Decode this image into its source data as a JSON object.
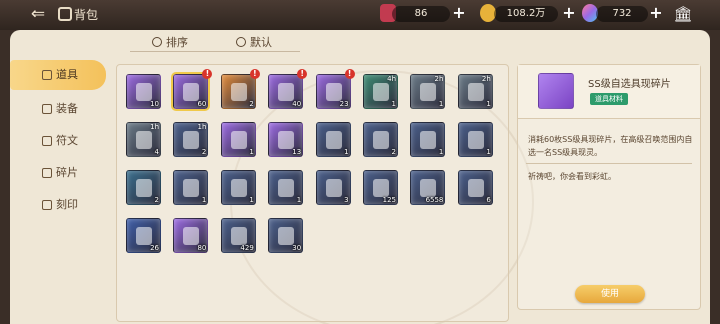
{
  "header": {
    "title": "背包",
    "back_icon": "back-arrow-icon",
    "bag_icon": "bag-icon",
    "resources": [
      {
        "name": "stamina-ticket",
        "value": "86",
        "color": "#c23b50"
      },
      {
        "name": "gold-coin",
        "value": "108.2万",
        "color": "#e7b23a"
      },
      {
        "name": "rainbow-gem",
        "value": "732",
        "color": "#9a6ae6"
      }
    ],
    "plus_label": "+",
    "bank_icon": "bank-icon"
  },
  "sortbar": {
    "sort_label": "排序",
    "default_label": "默认"
  },
  "sidebar": {
    "items": [
      {
        "label": "道具",
        "icon": "flask-icon",
        "active": true
      },
      {
        "label": "装备",
        "icon": "sword-icon",
        "active": false
      },
      {
        "label": "符文",
        "icon": "rune-icon",
        "active": false
      },
      {
        "label": "碎片",
        "icon": "shard-icon",
        "active": false
      },
      {
        "label": "刻印",
        "icon": "seal-icon",
        "active": false
      }
    ]
  },
  "items": [
    {
      "count": "10",
      "time": "",
      "alert": false,
      "color": "#9b6ae0",
      "selected": false
    },
    {
      "count": "60",
      "time": "",
      "alert": true,
      "color": "#9b6ae0",
      "selected": true
    },
    {
      "count": "2",
      "time": "",
      "alert": true,
      "color": "#e08a3a",
      "selected": false
    },
    {
      "count": "40",
      "time": "",
      "alert": true,
      "color": "#9b6ae0",
      "selected": false
    },
    {
      "count": "23",
      "time": "",
      "alert": true,
      "color": "#9b6ae0",
      "selected": false
    },
    {
      "count": "1",
      "time": "4h",
      "alert": false,
      "color": "#3d8a72",
      "selected": false
    },
    {
      "count": "1",
      "time": "2h",
      "alert": false,
      "color": "#6a7a86",
      "selected": false
    },
    {
      "count": "1",
      "time": "2h",
      "alert": false,
      "color": "#6a7a86",
      "selected": false
    },
    {
      "count": "4",
      "time": "1h",
      "alert": false,
      "color": "#6a7a86",
      "selected": false
    },
    {
      "count": "2",
      "time": "1h",
      "alert": false,
      "color": "#4a5f8a",
      "selected": false
    },
    {
      "count": "1",
      "time": "",
      "alert": false,
      "color": "#9b6ae0",
      "selected": false
    },
    {
      "count": "13",
      "time": "",
      "alert": false,
      "color": "#9b6ae0",
      "selected": false
    },
    {
      "count": "1",
      "time": "",
      "alert": false,
      "color": "#4a5f8a",
      "selected": false
    },
    {
      "count": "2",
      "time": "",
      "alert": false,
      "color": "#4a5f8a",
      "selected": false
    },
    {
      "count": "1",
      "time": "",
      "alert": false,
      "color": "#4a5f8a",
      "selected": false
    },
    {
      "count": "1",
      "time": "",
      "alert": false,
      "color": "#4a5f8a",
      "selected": false
    },
    {
      "count": "2",
      "time": "",
      "alert": false,
      "color": "#3a6e8c",
      "selected": false
    },
    {
      "count": "1",
      "time": "",
      "alert": false,
      "color": "#4a5f8a",
      "selected": false
    },
    {
      "count": "1",
      "time": "",
      "alert": false,
      "color": "#4a5f8a",
      "selected": false
    },
    {
      "count": "1",
      "time": "",
      "alert": false,
      "color": "#4a5f8a",
      "selected": false
    },
    {
      "count": "3",
      "time": "",
      "alert": false,
      "color": "#4a5f8a",
      "selected": false
    },
    {
      "count": "125",
      "time": "",
      "alert": false,
      "color": "#4a5f8a",
      "selected": false
    },
    {
      "count": "6558",
      "time": "",
      "alert": false,
      "color": "#4a5f8a",
      "selected": false
    },
    {
      "count": "6",
      "time": "",
      "alert": false,
      "color": "#4a5f8a",
      "selected": false
    },
    {
      "count": "26",
      "time": "",
      "alert": false,
      "color": "#3f5ea8",
      "selected": false
    },
    {
      "count": "80",
      "time": "",
      "alert": false,
      "color": "#9b6ae0",
      "selected": false
    },
    {
      "count": "429",
      "time": "",
      "alert": false,
      "color": "#4a5f8a",
      "selected": false
    },
    {
      "count": "30",
      "time": "",
      "alert": false,
      "color": "#4a5f8a",
      "selected": false
    }
  ],
  "detail": {
    "title": "SS级自选具现碎片",
    "badge": "道具材料",
    "description": "消耗60枚SS级具现碎片，在高级召唤范围内自选一名SS级具现灵。",
    "flavor": "祈祷吧，你会看到彩虹。",
    "use_label": "使用",
    "icon": "purple-card-shard-icon"
  }
}
